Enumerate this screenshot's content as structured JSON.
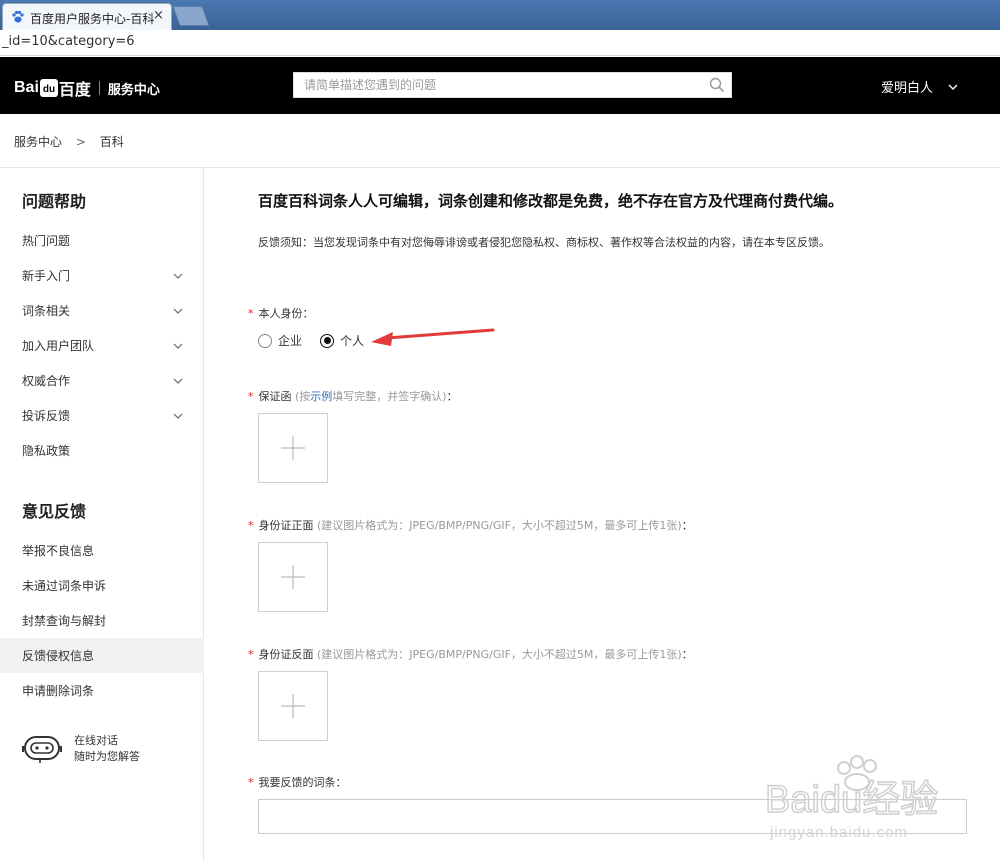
{
  "browser": {
    "tab_title": "百度用户服务中心-百科",
    "tab_close": "×",
    "url": "_id=10&category=6"
  },
  "header": {
    "logo_bai": "Bai",
    "logo_du": "百度",
    "logo_service": "服务中心",
    "search_placeholder": "请简单描述您遇到的问题",
    "user_name": "爱明白人"
  },
  "breadcrumb": {
    "root": "服务中心",
    "sep": ">",
    "current": "百科"
  },
  "sidebar": {
    "help_heading": "问题帮助",
    "help_items": [
      {
        "label": "热门问题"
      },
      {
        "label": "新手入门"
      },
      {
        "label": "词条相关"
      },
      {
        "label": "加入用户团队"
      },
      {
        "label": "权威合作"
      },
      {
        "label": "投诉反馈"
      },
      {
        "label": "隐私政策"
      }
    ],
    "feedback_heading": "意见反馈",
    "feedback_items": [
      {
        "label": "举报不良信息"
      },
      {
        "label": "未通过词条申诉"
      },
      {
        "label": "封禁查询与解封"
      },
      {
        "label": "反馈侵权信息"
      },
      {
        "label": "申请删除词条"
      }
    ],
    "online_line1": "在线对话",
    "online_line2": "随时为您解答"
  },
  "main": {
    "title": "百度百科词条人人可编辑，词条创建和修改都是免费，绝不存在官方及代理商付费代编。",
    "notice": "反馈须知：当您发现词条中有对您侮辱诽谤或者侵犯您隐私权、商标权、著作权等合法权益的内容，请在本专区反馈。",
    "identity": {
      "req": "*",
      "label": "本人身份：",
      "option_company": "企业",
      "option_personal": "个人",
      "selected": "个人"
    },
    "guarantee": {
      "req": "*",
      "label": "保证函",
      "hint_open": "(按",
      "hint_link": "示例",
      "hint_rest": "填写完整，并签字确认)",
      "colon": "："
    },
    "id_front": {
      "req": "*",
      "label": "身份证正面",
      "hint": "(建议图片格式为：JPEG/BMP/PNG/GIF，大小不超过5M，最多可上传1张)",
      "colon": "："
    },
    "id_back": {
      "req": "*",
      "label": "身份证反面",
      "hint": "(建议图片格式为：JPEG/BMP/PNG/GIF，大小不超过5M，最多可上传1张)",
      "colon": "："
    },
    "entry": {
      "req": "*",
      "label": "我要反馈的词条："
    }
  },
  "watermark": {
    "line1": "Baidu经验",
    "line2": "jingyan.baidu.com"
  },
  "colors": {
    "header_bg": "#000000",
    "required": "#e02020",
    "link": "#2f6fbf",
    "annotation_arrow": "#e23b3b"
  }
}
